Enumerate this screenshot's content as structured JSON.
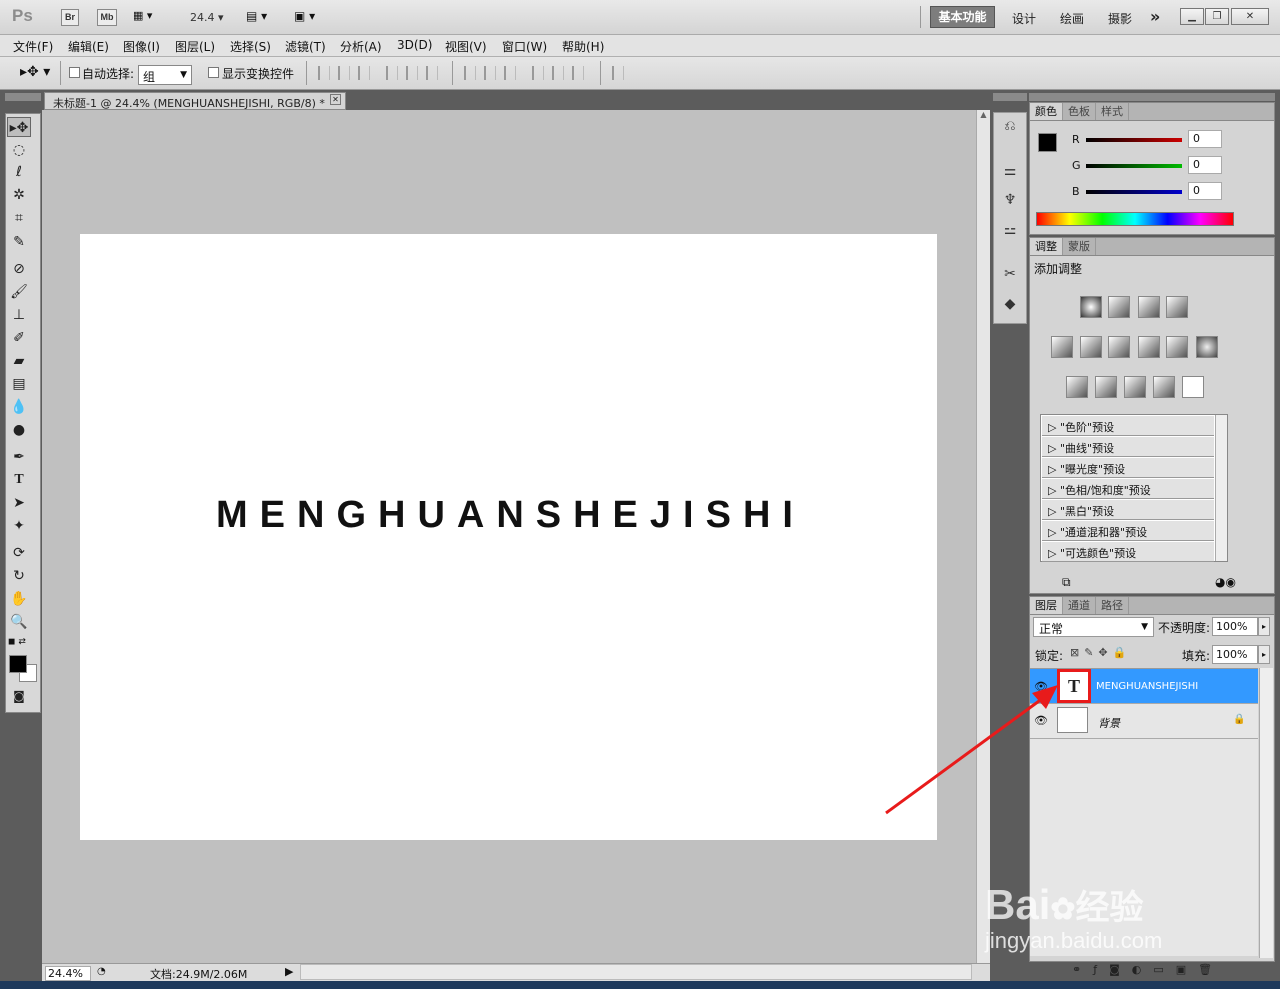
{
  "app": {
    "logo": "Ps",
    "bridge": "Br",
    "minibridge": "Mb",
    "zoom": "24.4",
    "workspaces": [
      "基本功能",
      "设计",
      "绘画",
      "摄影"
    ],
    "more": "»"
  },
  "menu": [
    "文件(F)",
    "编辑(E)",
    "图像(I)",
    "图层(L)",
    "选择(S)",
    "滤镜(T)",
    "分析(A)",
    "3D(D)",
    "视图(V)",
    "窗口(W)",
    "帮助(H)"
  ],
  "options": {
    "auto_select_label": "自动选择:",
    "auto_select_value": "组",
    "show_transform_label": "显示变换控件"
  },
  "document": {
    "tab_title": "未标题-1 @ 24.4% (MENGHUANSHEJISHI, RGB/8) *",
    "canvas_text": "MENGHUANSHEJISHI",
    "status_zoom": "24.4%",
    "status_doc": "文档:24.9M/2.06M"
  },
  "color_panel": {
    "tabs": [
      "颜色",
      "色板",
      "样式"
    ],
    "channels": [
      {
        "label": "R",
        "value": "0",
        "color": "#cc0000"
      },
      {
        "label": "G",
        "value": "0",
        "color": "#00bb00"
      },
      {
        "label": "B",
        "value": "0",
        "color": "#0000cc"
      }
    ]
  },
  "adjust_panel": {
    "tabs": [
      "调整",
      "蒙版"
    ],
    "title": "添加调整",
    "presets": [
      "\"色阶\"预设",
      "\"曲线\"预设",
      "\"曝光度\"预设",
      "\"色相/饱和度\"预设",
      "\"黑白\"预设",
      "\"通道混和器\"预设",
      "\"可选颜色\"预设"
    ]
  },
  "layers_panel": {
    "tabs": [
      "图层",
      "通道",
      "路径"
    ],
    "blend_mode": "正常",
    "opacity_label": "不透明度:",
    "opacity_value": "100%",
    "lock_label": "锁定:",
    "fill_label": "填充:",
    "fill_value": "100%",
    "layers": [
      {
        "name": "MENGHUANSHEJISHI",
        "thumb": "T"
      },
      {
        "name": "背景"
      }
    ]
  },
  "watermark": {
    "brand": "Bai",
    "brand2": "经验",
    "url": "jingyan.baidu.com"
  }
}
